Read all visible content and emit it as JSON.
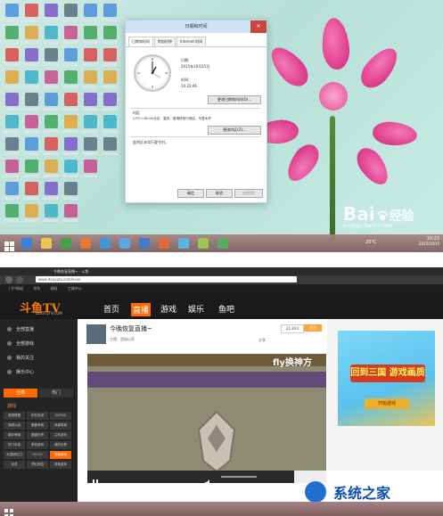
{
  "top_screen": {
    "dialog": {
      "title": "日期和时间",
      "close": "✕",
      "tabs": [
        "日期和时间",
        "附加时钟",
        "Internet 时间"
      ],
      "date_label": "日期:",
      "date_value": "2015年10月15日",
      "time_label": "时间:",
      "time_value": "10:22:46",
      "change_datetime_button": "更改日期和时间(D)...",
      "timezone_heading": "时区",
      "timezone_value": "(UTC+08:00)北京，重庆，香港特别行政区，乌鲁木齐",
      "change_timezone_button": "更改时区(Z)...",
      "dst_note": "此时区未实行夏令时。",
      "ok_button": "确定",
      "cancel_button": "取消",
      "apply_button": "应用(A)"
    },
    "watermark": {
      "brand": "Bai",
      "brand2": "经验",
      "url": "jingyan.baidu.com"
    },
    "taskbar": {
      "weather": "20°C",
      "time": "10:23",
      "date": "2015/10/15"
    }
  },
  "bottom_screen": {
    "browser": {
      "tab_title": "今晚恢复直播~ - 斗鱼",
      "url": "www.douyutv.com/xxxx",
      "bookmarks": [
        "门户网站",
        "京东",
        "网址",
        "工具中心"
      ]
    },
    "site": {
      "logo": "斗鱼TV",
      "logo_sub": "DOUYUTV.COM",
      "nav": [
        "首页",
        "直播",
        "游戏",
        "娱乐",
        "鱼吧"
      ],
      "nav_active_index": 1,
      "left_nav": [
        "全部直播",
        "全部游戏",
        "我的关注",
        "娱乐中心"
      ],
      "tab_hot": "分类",
      "tab_more": "热门",
      "section_games": "游戏",
      "categories": [
        "英雄联盟",
        "炉石传说",
        "DOTA2",
        "穿越火线",
        "魔兽争霸",
        "风暴英雄",
        "星际争霸",
        "魔兽世界",
        "主机游戏",
        "热门手游",
        "单机游戏",
        "我的世界",
        "天涯明月刀",
        "CS:GO",
        "全部游戏",
        "剑灵",
        "梦幻西游",
        "其他游戏"
      ],
      "room_title": "今晚恢复直播~",
      "room_meta": "主播：超级玩家",
      "overlay_text": "fly换神方",
      "follow_count": "21,834",
      "follow_label": "关注",
      "share_label": "分享",
      "ad_title": "回到三国 游戏画质",
      "ad_button": "开始游戏",
      "watermark_text": "系统之家"
    }
  }
}
